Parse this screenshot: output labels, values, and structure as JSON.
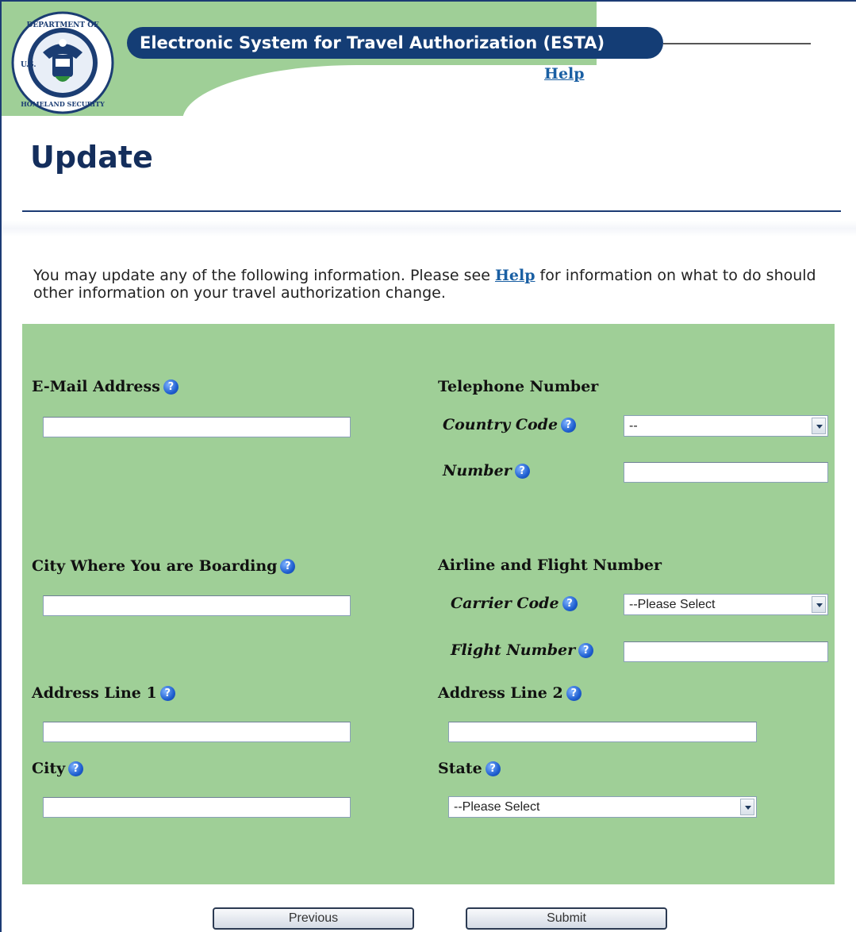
{
  "header": {
    "title": "Electronic System for Travel Authorization (ESTA)",
    "help_label": "Help",
    "seal_text_top": "DEPARTMENT OF",
    "seal_text_bottom": "HOMELAND SECURITY",
    "seal_text_left": "U.S."
  },
  "page_title": "Update",
  "intro": {
    "text_before": "You may update any of the following information. Please see ",
    "link": "Help",
    "text_after": " for information on what to do should other information on your travel authorization change."
  },
  "form": {
    "email": {
      "label": "E-Mail Address",
      "value": ""
    },
    "telephone": {
      "label": "Telephone Number",
      "country_code_label": "Country Code",
      "country_code_value": "--",
      "number_label": "Number",
      "number_value": ""
    },
    "boarding_city": {
      "label": "City Where You are Boarding",
      "value": ""
    },
    "airline": {
      "label": "Airline and Flight Number",
      "carrier_label": "Carrier Code",
      "carrier_value": "--Please Select",
      "flight_label": "Flight Number",
      "flight_value": ""
    },
    "address1": {
      "label": "Address Line 1",
      "value": ""
    },
    "address2": {
      "label": "Address Line 2",
      "value": ""
    },
    "city": {
      "label": "City",
      "value": ""
    },
    "state": {
      "label": "State",
      "value": "--Please Select"
    },
    "help_icon": "?"
  },
  "buttons": {
    "previous": "Previous",
    "submit": "Submit"
  },
  "colors": {
    "brand_navy": "#143d75",
    "panel_green": "#9fcf97",
    "link_blue": "#1a5fa3"
  }
}
